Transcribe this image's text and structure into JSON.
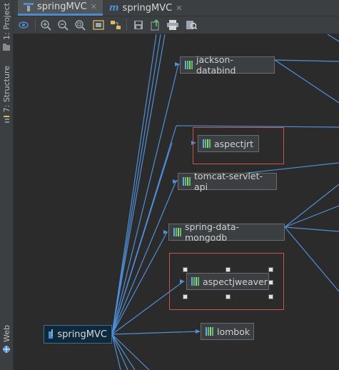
{
  "sidebar": {
    "project_tab": "1: Project",
    "structure_tab": "7: Structure",
    "web_tab": "Web"
  },
  "tabs": [
    {
      "label": "springMVC",
      "active": true
    },
    {
      "label": "springMVC",
      "active": false
    }
  ],
  "toolbar": {
    "buttons": [
      "eye-icon",
      "zoom-in-icon",
      "zoom-out-icon",
      "actual-size-icon",
      "fit-content-icon",
      "layout-icon",
      "save-icon",
      "export-icon",
      "print-icon",
      "find-icon"
    ]
  },
  "diagram": {
    "root": "springMVC",
    "nodes": [
      "jackson-databind",
      "aspectjrt",
      "tomcat-servlet-api",
      "spring-data-mongodb",
      "aspectjweaver",
      "lombok"
    ]
  },
  "colors": {
    "edge": "#4f8fd8",
    "highlight": "#c75450",
    "background": "#2b2b2b"
  }
}
